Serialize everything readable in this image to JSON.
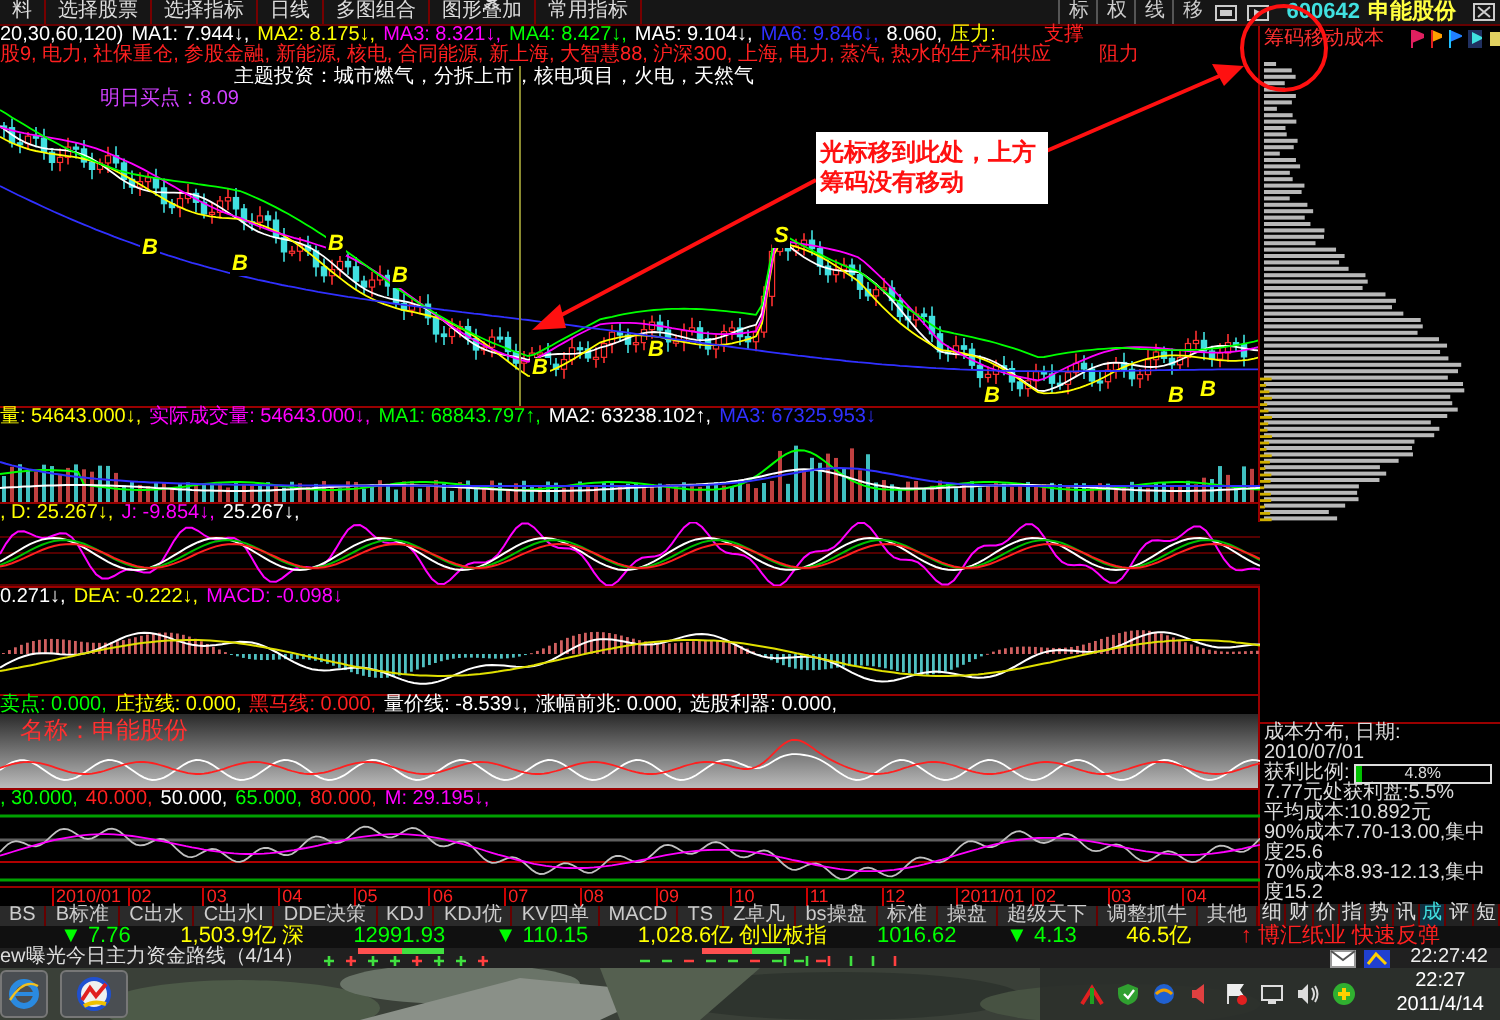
{
  "menu": {
    "items": [
      "料",
      "选择股票",
      "选择指标",
      "日线",
      "多图组合",
      "图形叠加",
      "常用指标"
    ],
    "tools": [
      "标",
      "权",
      "线",
      "移"
    ]
  },
  "stock": {
    "code": "600642",
    "name": "申能股份"
  },
  "ma_line": [
    {
      "text": "20,30,60,120)",
      "color": "#ffffff"
    },
    {
      "text": "MA1: 7.944↓,",
      "color": "#ffffff"
    },
    {
      "text": "MA2: 8.175↓,",
      "color": "#ffff00"
    },
    {
      "text": "MA3: 8.321↓,",
      "color": "#ff00ff"
    },
    {
      "text": "MA4: 8.427↓,",
      "color": "#00ff00"
    },
    {
      "text": "MA5: 9.104↓,",
      "color": "#ffffff"
    },
    {
      "text": "MA6: 9.846↓,",
      "color": "#3030ff"
    },
    {
      "text": "8.060,",
      "color": "#ffffff"
    },
    {
      "text": "压力:",
      "color": "#ffff00"
    }
  ],
  "levels": [
    "支撑",
    "阻力"
  ],
  "concepts": "股9, 电力, 社保重仓, 参股金融, 新能源, 核电, 合同能源, 新上海, 大智慧88, 沪深300, 上海, 电力, 蒸汽, 热水的生产和供应",
  "topic": "主题投资：城市燃气，分拆上市，核电项目，火电，天然气",
  "buy_point": "明日买点：8.09",
  "signals": [
    "B",
    "B",
    "B",
    "B",
    "B",
    "B",
    "S",
    "B",
    "B",
    "B"
  ],
  "annotation": "光标移到此处，上方筹码没有移动",
  "volume_line": [
    {
      "text": "量: 54643.000↓,",
      "color": "#ffff00"
    },
    {
      "text": "实际成交量: 54643.000↓,",
      "color": "#ff00ff"
    },
    {
      "text": "MA1: 68843.797↑,",
      "color": "#00ff00"
    },
    {
      "text": "MA2: 63238.102↑,",
      "color": "#ffffff"
    },
    {
      "text": "MA3: 67325.953↓",
      "color": "#3030ff"
    }
  ],
  "kdj_line": [
    {
      "text": ", D: 25.267↓,",
      "color": "#ffff00"
    },
    {
      "text": "J: -9.854↓,",
      "color": "#ff00ff"
    },
    {
      "text": "25.267↓,",
      "color": "#ffffff"
    }
  ],
  "macd_line": [
    {
      "text": "0.271↓,",
      "color": "#ffffff"
    },
    {
      "text": "DEA: -0.222↓,",
      "color": "#ffff00"
    },
    {
      "text": "MACD: -0.098↓",
      "color": "#ff00ff"
    }
  ],
  "signal_line": [
    {
      "text": "卖点: 0.000,",
      "color": "#00ff00"
    },
    {
      "text": "庄拉线: 0.000,",
      "color": "#ffff00"
    },
    {
      "text": "黑马线: 0.000,",
      "color": "#ff2020"
    },
    {
      "text": "量价线: -8.539↓,",
      "color": "#ffffff"
    },
    {
      "text": "涨幅前兆: 0.000,",
      "color": "#ffffff"
    },
    {
      "text": "选股利器: 0.000,",
      "color": "#ffffff"
    }
  ],
  "panel_label": "名称：申能股份",
  "band_line": [
    {
      "text": ", 30.000,",
      "color": "#00ff00"
    },
    {
      "text": "40.000,",
      "color": "#ff2020"
    },
    {
      "text": "50.000,",
      "color": "#ffffff"
    },
    {
      "text": "65.000,",
      "color": "#00ff00"
    },
    {
      "text": "80.000,",
      "color": "#ff2020"
    },
    {
      "text": "M: 29.195↓,",
      "color": "#ff00ff"
    }
  ],
  "dates": [
    "2010/01",
    "02",
    "03",
    "04",
    "05",
    "06",
    "07",
    "08",
    "09",
    "10",
    "11",
    "12",
    "2011/01",
    "02",
    "03",
    "04"
  ],
  "indicator_tabs": [
    "BS",
    "B标准",
    "C出水",
    "C出水I",
    "DDE决策",
    "KDJ",
    "KDJ优",
    "KV四单",
    "MACD",
    "TS",
    "Z卓凡",
    "bs操盘",
    "标准",
    "操盘",
    "超级天下",
    "调整抓牛",
    "其他"
  ],
  "chip_panel": {
    "title": "筹码移动成本",
    "date_line": "成本分布, 日期: 2010/07/01",
    "ratio_label": "获利比例:",
    "ratio": "4.8%",
    "level": 0.048,
    "stats": [
      "7.77元处获利盘:5.5%",
      "平均成本:10.892元",
      "90%成本7.70-13.00,集中度25.6",
      "70%成本8.93-12.13,集中度15.2"
    ]
  },
  "side_tabs": [
    {
      "label": "细",
      "selected": false
    },
    {
      "label": "财",
      "selected": false
    },
    {
      "label": "价",
      "selected": false
    },
    {
      "label": "指",
      "selected": false
    },
    {
      "label": "势",
      "selected": false
    },
    {
      "label": "讯",
      "selected": false
    },
    {
      "label": "成",
      "selected": true
    },
    {
      "label": "评",
      "selected": false
    },
    {
      "label": "短",
      "selected": false
    }
  ],
  "market": [
    {
      "text": "▼ 7.76",
      "color": "#00ff00"
    },
    {
      "text": "1,503.9亿 深",
      "color": "#ffff00"
    },
    {
      "text": "12991.93",
      "color": "#00ff00"
    },
    {
      "text": "▼ 110.15",
      "color": "#00ff00"
    },
    {
      "text": "1,028.6亿 创业板指",
      "color": "#ffff00"
    },
    {
      "text": "1016.62",
      "color": "#00ff00"
    },
    {
      "text": "▼ 4.13",
      "color": "#00ff00"
    },
    {
      "text": "46.5亿",
      "color": "#ffff00"
    },
    {
      "text": "↑ 博汇纸业 快速反弹",
      "color": "#ff2020"
    }
  ],
  "news": "ew曝光今日主力资金路线（4/14）",
  "clock": "22:27:42",
  "taskbar": {
    "time": "22:27",
    "date": "2011/4/14"
  }
}
